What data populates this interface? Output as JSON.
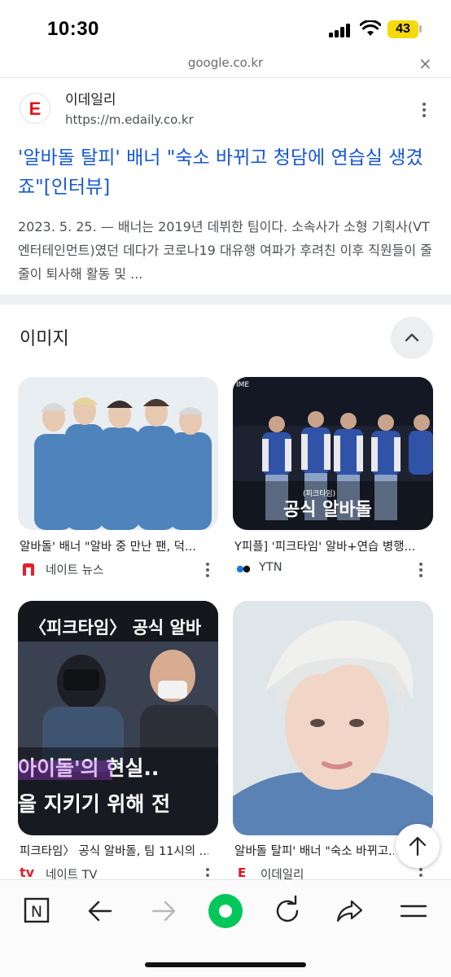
{
  "status": {
    "time": "10:30",
    "battery": "43"
  },
  "browser": {
    "url": "google.co.kr",
    "close_glyph": "×"
  },
  "result": {
    "logo_letter": "E",
    "site_name": "이데일리",
    "site_url": "https://m.edaily.co.kr",
    "title": "'알바돌 탈피' 배너 \"숙소 바뀌고 청담에 연습실 생겼죠\"[인터뷰]",
    "snippet": "2023. 5. 25. — 배너는 2019년 데뷔한 팀이다. 소속사가 소형 기획사(VT엔터테인먼트)였던 데다가 코로나19 대유행 여파가 후려친 이후 직원들이 줄줄이 퇴사해 활동 및 ..."
  },
  "images_section": {
    "header": "이미지",
    "items": [
      {
        "caption": "알바돌' 배너 \"알바 중 만난 팬, 덕...",
        "source": "네이트 뉴스",
        "source_icon": "nate-news-icon",
        "image": "group-photo-denim"
      },
      {
        "caption": "Y피플] '피크타임' 알바+연습 병행...",
        "source": "YTN",
        "source_icon": "ytn-icon",
        "image": "stage-photo",
        "overlay_small": "(피크타임)",
        "overlay_text": "공식 알바돌",
        "overlay_corner": "IME"
      },
      {
        "caption": "피크타임〉 공식 알바돌, 팀 11시의 ...",
        "source": "네이트 TV",
        "source_icon": "nate-tv-icon",
        "image": "video-thumbnail",
        "overlay_top": "〈피크타임〉 공식 알바",
        "overlay_mid": "아이돌'의 현실..",
        "overlay_bottom": "을 지키기 위해 전"
      },
      {
        "caption": "알바돌 탈피' 배너 \"숙소 바뀌고...",
        "source": "이데일리",
        "source_icon": "edaily-icon",
        "image": "portrait-photo"
      }
    ]
  },
  "toolbar": {
    "items": [
      "naver-n-icon",
      "back-arrow-icon",
      "forward-arrow-icon",
      "green-dot-icon",
      "refresh-icon",
      "share-icon",
      "menu-icon"
    ],
    "n_label": "N"
  },
  "colors": {
    "link": "#1558d6",
    "divider": "#eef0f2",
    "naver_green": "#03c75a",
    "battery": "#f5d90a"
  }
}
